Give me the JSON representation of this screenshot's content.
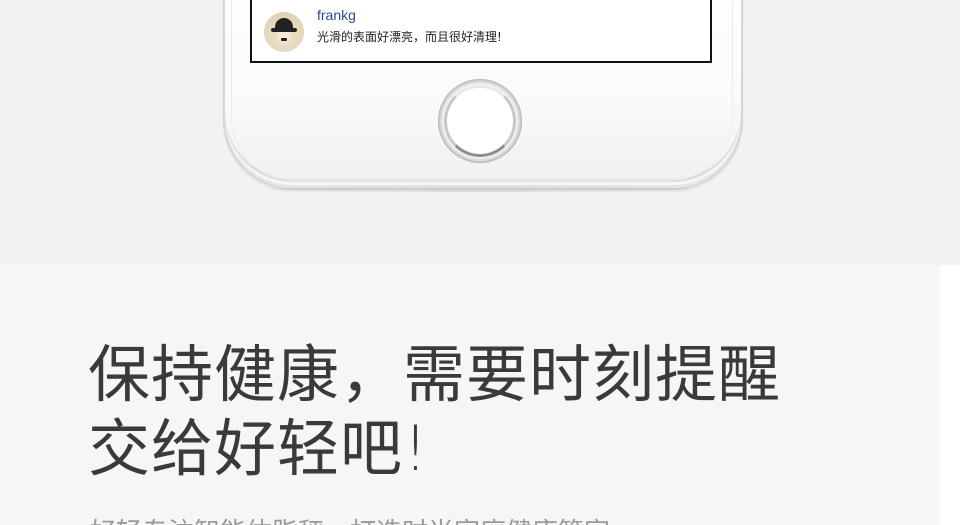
{
  "comment": {
    "username": "frankg",
    "text": "光滑的表面好漂亮，而且很好清理!"
  },
  "headline": {
    "line1": "保持健康，需要时刻提醒",
    "line2": "交给好轻吧!"
  },
  "body_text": "好轻专注智能体脂秤，打造时尚家庭健康管家",
  "icons": {
    "avatar": "bowler-hat-avatar",
    "home_button": "home-button"
  },
  "colors": {
    "username": "#2c4a8a",
    "headline": "#3a3a3a",
    "background": "#f3f3f3"
  }
}
